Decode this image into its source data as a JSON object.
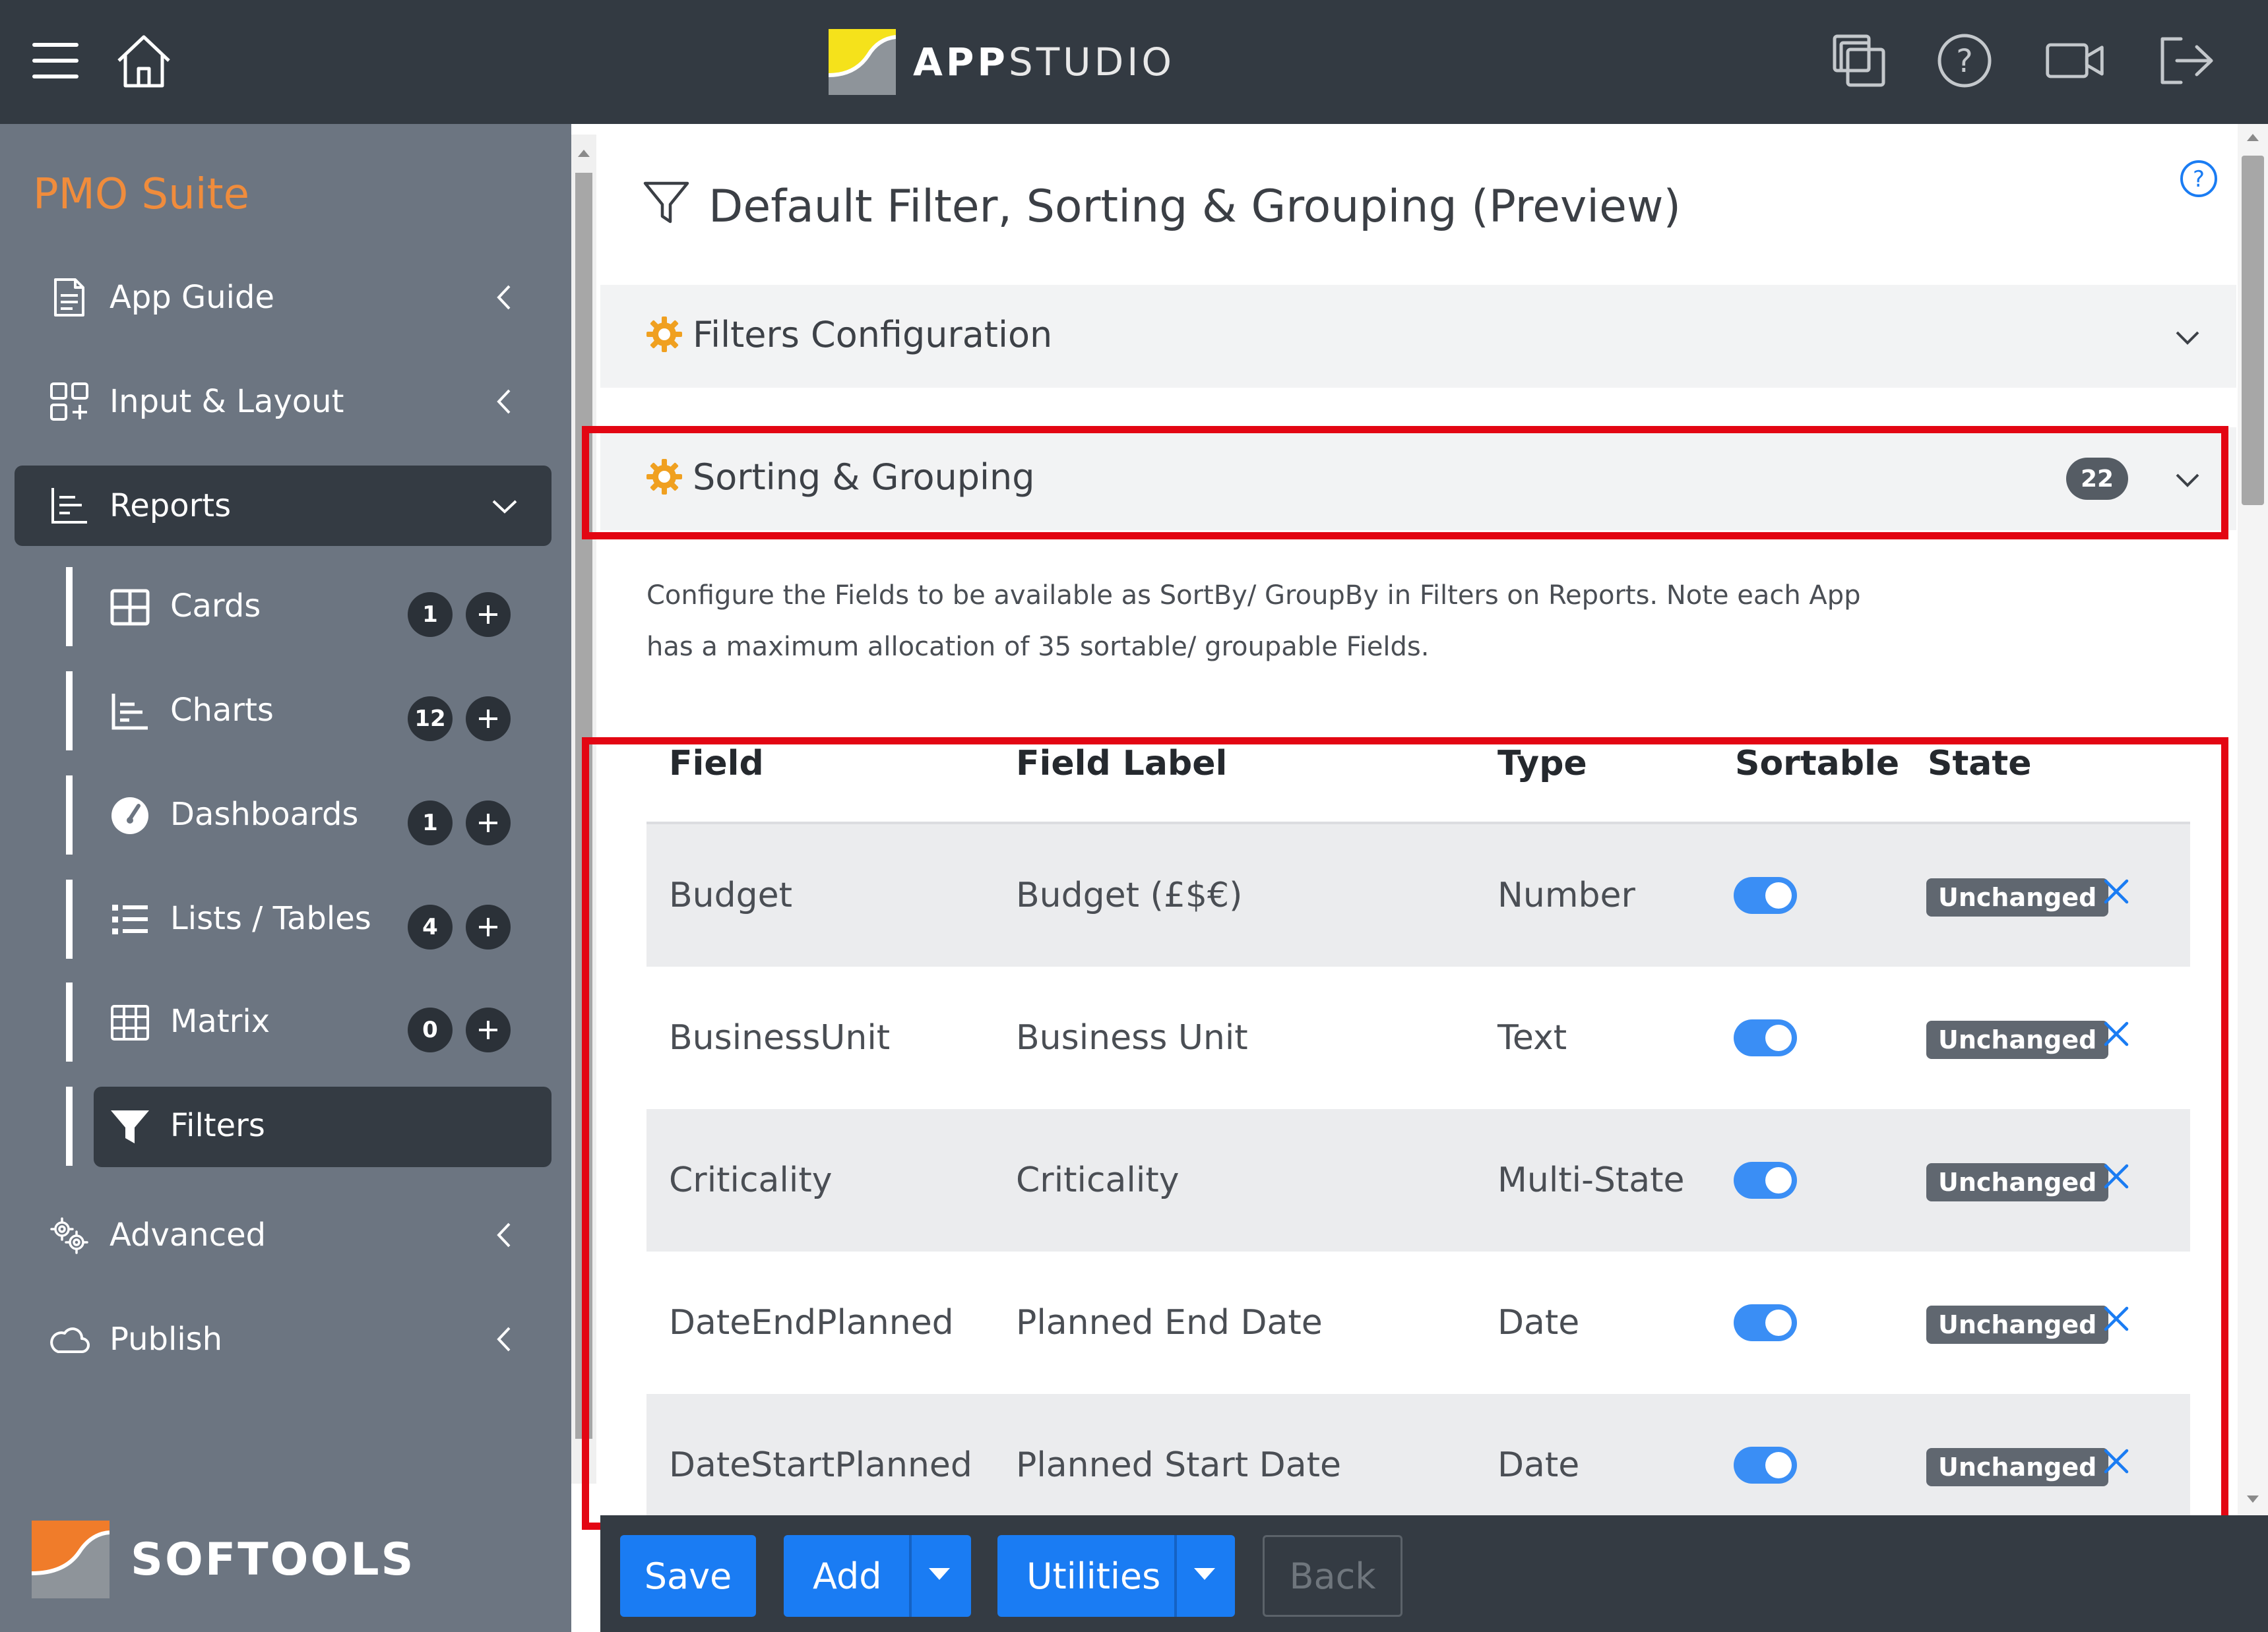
{
  "header": {
    "logo_text_a": "APP",
    "logo_text_b": "STUDIO",
    "icons": [
      "menu-icon",
      "home-icon",
      "copy-icon",
      "help-icon",
      "video-icon",
      "logout-icon"
    ]
  },
  "sidebar": {
    "brand": "PMO Suite",
    "items": [
      {
        "label": "App Guide",
        "icon": "document-icon"
      },
      {
        "label": "Input & Layout",
        "icon": "layout-icon"
      },
      {
        "label": "Reports",
        "icon": "chart-icon"
      },
      {
        "label": "Advanced",
        "icon": "gears-icon"
      },
      {
        "label": "Publish",
        "icon": "cloud-icon"
      }
    ],
    "reports_children": [
      {
        "label": "Cards",
        "count": "1"
      },
      {
        "label": "Charts",
        "count": "12"
      },
      {
        "label": "Dashboards",
        "count": "1"
      },
      {
        "label": "Lists / Tables",
        "count": "4"
      },
      {
        "label": "Matrix",
        "count": "0"
      },
      {
        "label": "Filters"
      }
    ],
    "footer_brand": "SOFTOOLS"
  },
  "main": {
    "title": "Default Filter, Sorting & Grouping (Preview)",
    "sections": [
      {
        "title": "Filters Configuration"
      },
      {
        "title": "Sorting & Grouping",
        "count": "22"
      }
    ],
    "description_line1": "Configure the Fields to be available as SortBy/ GroupBy in Filters on Reports. Note each App",
    "description_line2": "has a maximum allocation of 35 sortable/ groupable Fields.",
    "table": {
      "headers": [
        "Field",
        "Field Label",
        "Type",
        "Sortable",
        "State"
      ],
      "rows": [
        {
          "field": "Budget",
          "label": "Budget (£$€)",
          "type": "Number",
          "sortable": true,
          "state": "Unchanged"
        },
        {
          "field": "BusinessUnit",
          "label": "Business Unit",
          "type": "Text",
          "sortable": true,
          "state": "Unchanged"
        },
        {
          "field": "Criticality",
          "label": "Criticality",
          "type": "Multi-State",
          "sortable": true,
          "state": "Unchanged"
        },
        {
          "field": "DateEndPlanned",
          "label": "Planned End Date",
          "type": "Date",
          "sortable": true,
          "state": "Unchanged"
        },
        {
          "field": "DateStartPlanned",
          "label": "Planned Start Date",
          "type": "Date",
          "sortable": true,
          "state": "Unchanged"
        }
      ]
    }
  },
  "toolbar": {
    "save": "Save",
    "add": "Add",
    "utilities": "Utilities",
    "back": "Back"
  },
  "colors": {
    "header_bg": "#333a42",
    "sidebar_bg": "#6c7581",
    "brand_orange": "#f08c3c",
    "primary_blue": "#1a7cf3",
    "highlight_red": "#e30613",
    "gear_orange": "#f0a020"
  }
}
